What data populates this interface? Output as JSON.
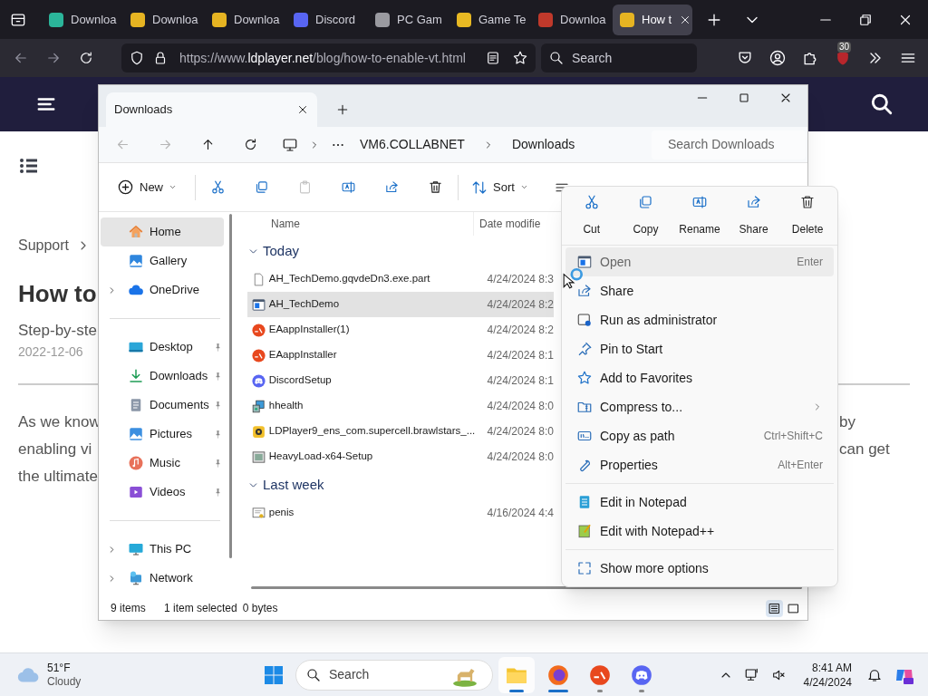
{
  "browser": {
    "tabs": [
      {
        "label": "Downloa",
        "color": "#2bb59a",
        "selected": false
      },
      {
        "label": "Downloa",
        "color": "#e6b422",
        "selected": false
      },
      {
        "label": "Downloa",
        "color": "#e6b422",
        "selected": false
      },
      {
        "label": "Discord",
        "color": "#5865f2",
        "selected": false
      },
      {
        "label": "PC Gam",
        "color": "#9a9aa0",
        "selected": false
      },
      {
        "label": "Game Te",
        "color": "#e8b923",
        "selected": false
      },
      {
        "label": "Downloa",
        "color": "#c0392b",
        "selected": false
      },
      {
        "label": "How t",
        "color": "#e6b422",
        "selected": true
      }
    ],
    "address": {
      "prefix": "https://www.",
      "domain": "ldplayer.net",
      "path": "/blog/how-to-enable-vt.html"
    },
    "search": {
      "placeholder": "Search"
    },
    "extension_badge": "30"
  },
  "page": {
    "breadcrumb": "Support",
    "title": "How to",
    "subtitle": "Step-by-ste",
    "date": "2022-12-06",
    "paragraph": [
      {
        "left": "As we know",
        "right": "by"
      },
      {
        "left": "enabling vi",
        "right": "can get"
      },
      {
        "left": "the ultimate"
      }
    ]
  },
  "explorer": {
    "tabs": [
      {
        "label": "Downloads",
        "selected": true
      }
    ],
    "path": [
      "VM6.COLLABNET",
      "Downloads"
    ],
    "search": {
      "placeholder": "Search Downloads"
    },
    "toolbar": {
      "new": "New",
      "sort": "Sort"
    },
    "sidebar": [
      [
        {
          "label": "Home",
          "kind": "home",
          "selected": true,
          "pinned": false,
          "expandable": false
        },
        {
          "label": "Gallery",
          "kind": "gallery",
          "selected": false,
          "pinned": false,
          "expandable": false
        },
        {
          "label": "OneDrive",
          "kind": "cloud",
          "selected": false,
          "pinned": false,
          "expandable": true
        }
      ],
      [
        {
          "label": "Desktop",
          "kind": "desktop",
          "selected": false,
          "pinned": true,
          "expandable": false
        },
        {
          "label": "Downloads",
          "kind": "download",
          "selected": false,
          "pinned": true,
          "expandable": false
        },
        {
          "label": "Documents",
          "kind": "documents",
          "selected": false,
          "pinned": true,
          "expandable": false
        },
        {
          "label": "Pictures",
          "kind": "pictures",
          "selected": false,
          "pinned": true,
          "expandable": false
        },
        {
          "label": "Music",
          "kind": "music",
          "selected": false,
          "pinned": true,
          "expandable": false
        },
        {
          "label": "Videos",
          "kind": "videos",
          "selected": false,
          "pinned": true,
          "expandable": false
        }
      ],
      [
        {
          "label": "This PC",
          "kind": "pc",
          "selected": false,
          "pinned": false,
          "expandable": true
        },
        {
          "label": "Network",
          "kind": "network",
          "selected": false,
          "pinned": false,
          "expandable": true
        }
      ]
    ],
    "columns": [
      "Name",
      "Date modifie"
    ],
    "groups": [
      {
        "label": "Today",
        "expanded": true,
        "files": [
          {
            "name": "AH_TechDemo.gqvdeDn3.exe.part",
            "date": "4/24/2024 8:3",
            "kind": "file",
            "selected": false
          },
          {
            "name": "AH_TechDemo",
            "date": "4/24/2024 8:2",
            "kind": "app",
            "selected": true
          },
          {
            "name": "EAappInstaller(1)",
            "date": "4/24/2024 8:2",
            "kind": "ea",
            "selected": false
          },
          {
            "name": "EAappInstaller",
            "date": "4/24/2024 8:1",
            "kind": "ea",
            "selected": false
          },
          {
            "name": "DiscordSetup",
            "date": "4/24/2024 8:1",
            "kind": "discord",
            "selected": false
          },
          {
            "name": "hhealth",
            "date": "4/24/2024 8:0",
            "kind": "installer",
            "selected": false
          },
          {
            "name": "LDPlayer9_ens_com.supercell.brawlstars_...",
            "date": "4/24/2024 8:0",
            "kind": "ldplayer",
            "selected": false
          },
          {
            "name": "HeavyLoad-x64-Setup",
            "date": "4/24/2024 8:0",
            "kind": "setup",
            "selected": false
          }
        ]
      },
      {
        "label": "Last week",
        "expanded": true,
        "files": [
          {
            "name": "penis",
            "date": "4/16/2024 4:4",
            "kind": "cert",
            "selected": false
          }
        ]
      }
    ],
    "status": {
      "count": "9 items",
      "selection": "1 item selected",
      "size": "0 bytes"
    },
    "views": [
      {
        "kind": "details",
        "selected": true
      },
      {
        "kind": "tiles",
        "selected": false
      }
    ]
  },
  "context_menu": {
    "quick_actions": [
      {
        "label": "Cut",
        "kind": "cut"
      },
      {
        "label": "Copy",
        "kind": "copy"
      },
      {
        "label": "Rename",
        "kind": "rename"
      },
      {
        "label": "Share",
        "kind": "share"
      },
      {
        "label": "Delete",
        "kind": "delete"
      }
    ],
    "sections": [
      [
        {
          "label": "Open",
          "shortcut": "Enter",
          "kind": "open",
          "highlighted": true,
          "submenu": false
        },
        {
          "label": "Share",
          "kind": "share",
          "highlighted": false,
          "submenu": false
        },
        {
          "label": "Run as administrator",
          "kind": "admin",
          "highlighted": false,
          "submenu": false
        },
        {
          "label": "Pin to Start",
          "kind": "pin",
          "highlighted": false,
          "submenu": false
        },
        {
          "label": "Add to Favorites",
          "kind": "favorite",
          "highlighted": false,
          "submenu": false
        },
        {
          "label": "Compress to...",
          "kind": "compress",
          "highlighted": false,
          "submenu": true
        },
        {
          "label": "Copy as path",
          "shortcut": "Ctrl+Shift+C",
          "kind": "path",
          "highlighted": false,
          "submenu": false
        },
        {
          "label": "Properties",
          "shortcut": "Alt+Enter",
          "kind": "wrench",
          "highlighted": false,
          "submenu": false
        }
      ],
      [
        {
          "label": "Edit in Notepad",
          "kind": "notepad",
          "highlighted": false,
          "submenu": false
        },
        {
          "label": "Edit with Notepad++",
          "kind": "notepadpp",
          "highlighted": false,
          "submenu": false
        }
      ],
      [
        {
          "label": "Show more options",
          "kind": "more",
          "highlighted": false,
          "submenu": false
        }
      ]
    ]
  },
  "taskbar": {
    "weather": {
      "temperature": "51°F",
      "condition": "Cloudy"
    },
    "search": {
      "placeholder": "Search"
    },
    "apps": [
      {
        "kind": "folder",
        "focused": true,
        "active": true
      },
      {
        "kind": "firefox",
        "focused": false,
        "active": true
      },
      {
        "kind": "ea",
        "focused": false,
        "active": false
      },
      {
        "kind": "discord",
        "focused": false,
        "active": false
      }
    ],
    "time": "8:41 AM",
    "date": "4/24/2024"
  }
}
